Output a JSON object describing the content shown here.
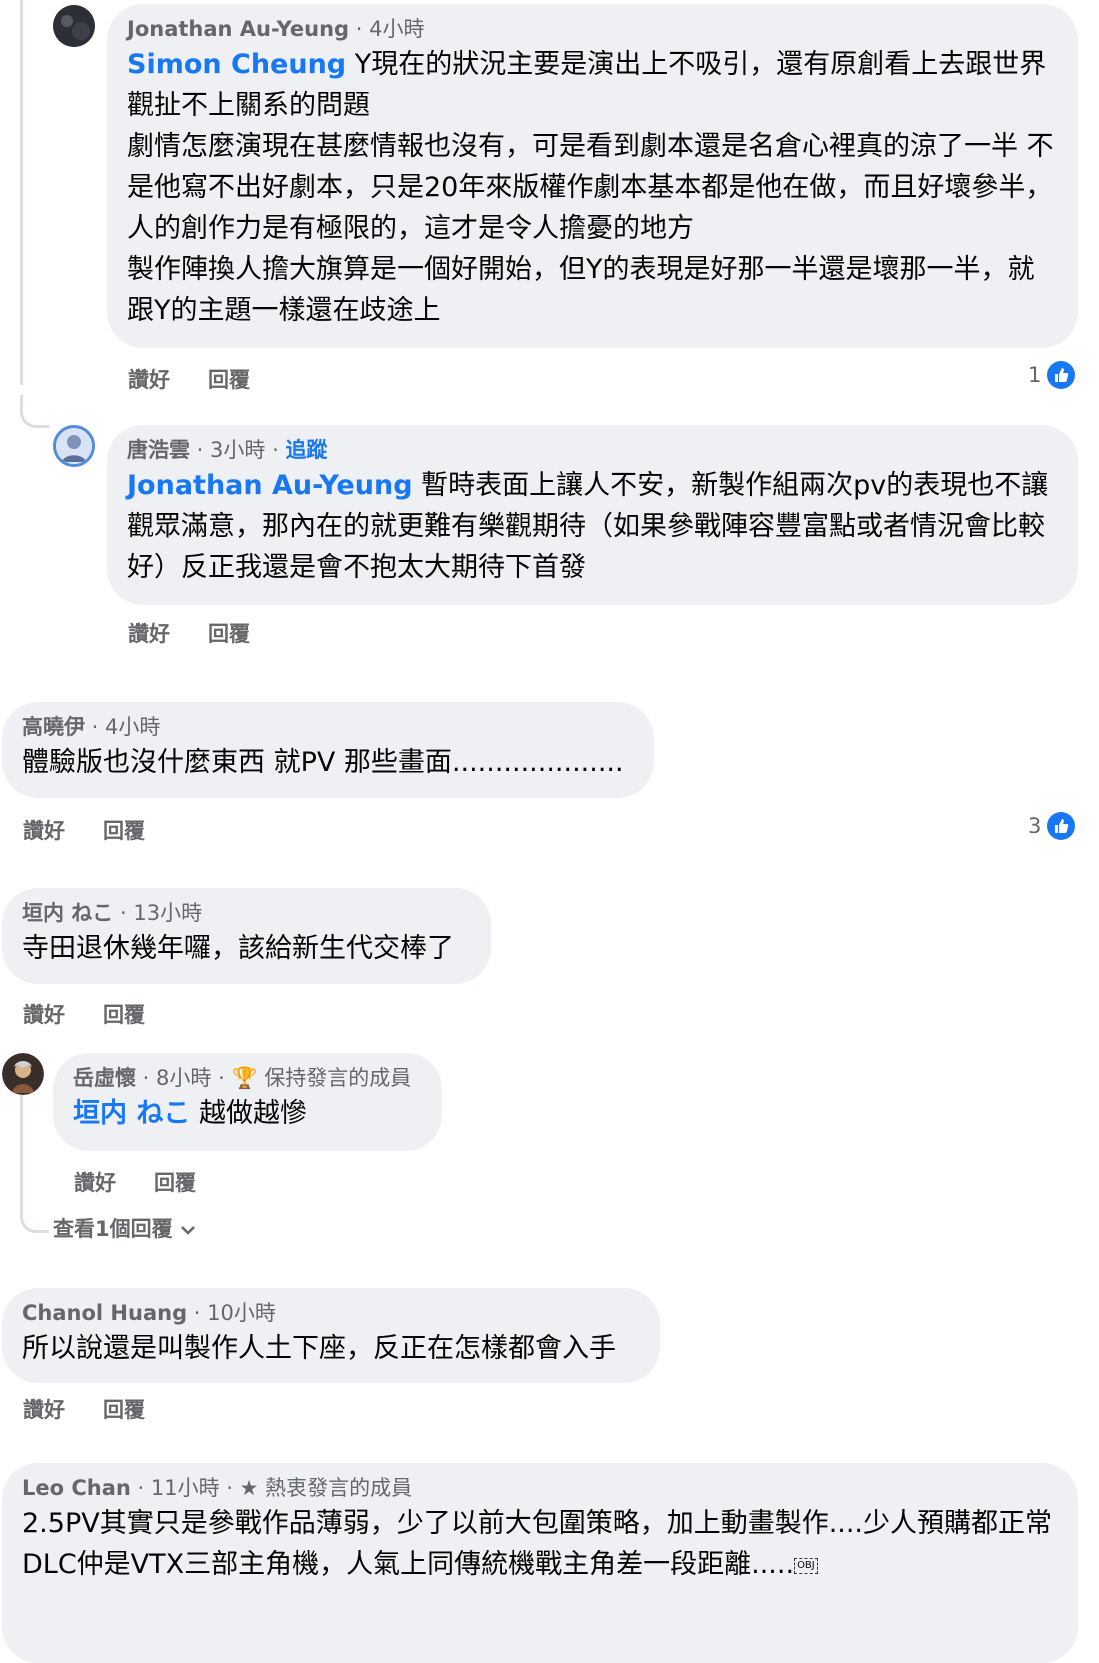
{
  "comments": [
    {
      "author": "Jonathan Au-Yeung",
      "time": "4小時",
      "tag": "Simon Cheung",
      "lines": [
        "Y現在的狀況主要是演出上不吸引，還有原創看上去跟世界觀扯不上關系的問題",
        "劇情怎麼演現在甚麼情報也沒有，可是看到劇本還是名倉心裡真的涼了一半 不是他寫不出好劇本，只是20年來版權作劇本基本都是他在做，而且好壞參半，人的創作力是有極限的，這才是令人擔憂的地方",
        "製作陣換人擔大旗算是一個好開始，但Y的表現是好那一半還是壞那一半，就跟Y的主題一樣還在歧途上"
      ],
      "like_label": "讚好",
      "reply_label": "回覆",
      "reactions": "1"
    },
    {
      "author": "唐浩雲",
      "time": "3小時",
      "follow": "追蹤",
      "tag": "Jonathan Au-Yeung",
      "text": " 暫時表面上讓人不安，新製作組兩次pv的表現也不讓觀眾滿意，那內在的就更難有樂觀期待（如果參戰陣容豐富點或者情況會比較好）反正我還是會不抱太大期待下首發",
      "like_label": "讚好",
      "reply_label": "回覆"
    },
    {
      "author": "高曉伊",
      "time": "4小時",
      "text": "體驗版也沒什麼東西  就PV 那些畫面....................",
      "like_label": "讚好",
      "reply_label": "回覆",
      "reactions": "3"
    },
    {
      "author": "垣内 ねこ",
      "time": "13小時",
      "text": "寺田退休幾年囉，該給新生代交棒了",
      "like_label": "讚好",
      "reply_label": "回覆"
    },
    {
      "author": "岳虛懷",
      "time": "8小時",
      "badge": "保持發言的成員",
      "tag": "垣内 ねこ",
      "text": " 越做越慘",
      "like_label": "讚好",
      "reply_label": "回覆"
    },
    {
      "author": "Chanol Huang",
      "time": "10小時",
      "text": "所以說還是叫製作人土下座，反正在怎樣都會入手",
      "like_label": "讚好",
      "reply_label": "回覆"
    },
    {
      "author": "Leo Chan",
      "time": "11小時",
      "badge": "熱衷發言的成員",
      "lines": [
        "2.5PV其實只是參戰作品薄弱，少了以前大包圍策略，加上動畫製作....少人預購都正常",
        "DLC仲是VTX三部主角機，人氣上同傳統機戰主角差一段距離....."
      ]
    }
  ],
  "view_replies": "查看1個回覆",
  "sep": " · ",
  "obj": "OBJ"
}
